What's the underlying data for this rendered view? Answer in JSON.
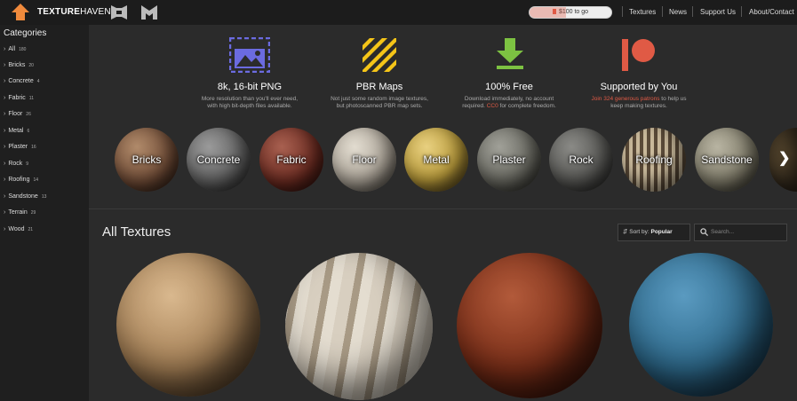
{
  "brand": {
    "name_bold": "TEXTURE",
    "name_thin": "HAVEN"
  },
  "goal": {
    "text": "$100 to go",
    "progress": 0.45
  },
  "nav": [
    "Textures",
    "News",
    "Support Us",
    "About/Contact"
  ],
  "sidebar": {
    "heading": "Categories",
    "items": [
      {
        "label": "All",
        "count": "180"
      },
      {
        "label": "Bricks",
        "count": "20"
      },
      {
        "label": "Concrete",
        "count": "4"
      },
      {
        "label": "Fabric",
        "count": "11"
      },
      {
        "label": "Floor",
        "count": "26"
      },
      {
        "label": "Metal",
        "count": "6"
      },
      {
        "label": "Plaster",
        "count": "16"
      },
      {
        "label": "Rock",
        "count": "9"
      },
      {
        "label": "Roofing",
        "count": "14"
      },
      {
        "label": "Sandstone",
        "count": "13"
      },
      {
        "label": "Terrain",
        "count": "29"
      },
      {
        "label": "Wood",
        "count": "21"
      }
    ]
  },
  "features": [
    {
      "icon": "image-icon",
      "title": "8k, 16-bit PNG",
      "desc1": "More resolution than you'll ever need,",
      "desc2": "with high bit-depth files available."
    },
    {
      "icon": "stripes-icon",
      "title": "PBR Maps",
      "desc1": "Not just some random image textures,",
      "desc2": "but photoscanned PBR map sets."
    },
    {
      "icon": "download-icon",
      "title": "100% Free",
      "desc1": "Download immediately, no account",
      "desc2_pre": "required. ",
      "desc2_hl": "CC0",
      "desc2_post": " for complete freedom."
    },
    {
      "icon": "patreon-icon",
      "title": "Supported by You",
      "desc1_hl": "Join 324 generous patrons",
      "desc1_post": " to help us",
      "desc2": "keep making textures."
    }
  ],
  "categories": [
    "Bricks",
    "Concrete",
    "Fabric",
    "Floor",
    "Metal",
    "Plaster",
    "Rock",
    "Roofing",
    "Sandstone"
  ],
  "section": {
    "title": "All Textures",
    "sort_prefix": "Sort by: ",
    "sort_value": "Popular",
    "search_placeholder": "Search..."
  },
  "colors": {
    "accent": "#e05a45",
    "green": "#7dc242",
    "yellow": "#f5c518",
    "purple": "#6b6be0"
  }
}
